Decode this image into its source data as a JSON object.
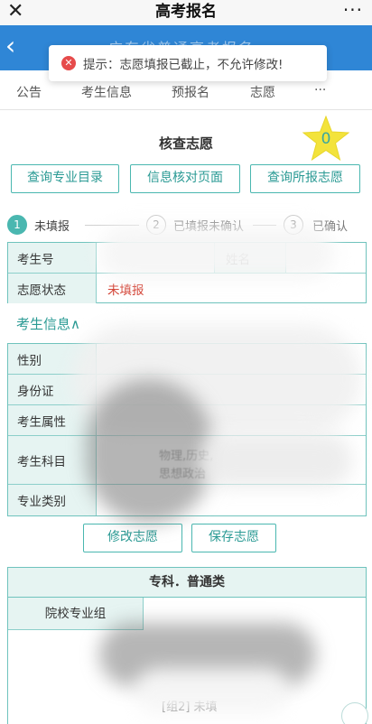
{
  "topbar": {
    "close_glyph": "✕",
    "title": "高考报名",
    "more_glyph": "···"
  },
  "bluebar": {
    "back_glyph": "‹",
    "subtitle": "广东省普通高考报名"
  },
  "toast": {
    "icon": "error-icon",
    "icon_glyph": "✕",
    "message": "提示：志愿填报已截止，不允许修改!"
  },
  "nav": {
    "tabs": [
      "公告",
      "考生信息",
      "预报名",
      "志愿",
      "···"
    ]
  },
  "page_title": "核查志愿",
  "star_badge": {
    "value": "0",
    "color": "#f3e33b"
  },
  "action_buttons": {
    "query_major": "查询专业目录",
    "verify_info": "信息核对页面",
    "query_applied": "查询所报志愿"
  },
  "steps": [
    {
      "num": "1",
      "label": "未填报"
    },
    {
      "num": "2",
      "label": "已填报未确认"
    },
    {
      "num": "3",
      "label": "已确认"
    }
  ],
  "status_table": {
    "exam_no_label": "考生号",
    "name_label": "姓名",
    "status_label": "志愿状态",
    "status_value": "未填报"
  },
  "info_section": {
    "title": "考生信息",
    "toggle_glyph": "∧"
  },
  "info_table": {
    "gender_label": "性别",
    "id_label": "身份证",
    "residence_label": "考生属性",
    "subjects_label": "考生科目",
    "subjects_value_line1": "物理,历史,",
    "subjects_value_line2": "思想政治",
    "major_type_label": "专业类别"
  },
  "bottom_buttons": {
    "edit": "修改志愿",
    "save": "保存志愿"
  },
  "choice_table": {
    "header": "专科．普通类",
    "group_label": "院校专业组",
    "tail_text": "[组2] 未填"
  },
  "colors": {
    "accent": "#4ab7b0",
    "blue_bar": "#2f86d6",
    "error_red": "#e64b4b",
    "status_red": "#d23a2c"
  }
}
